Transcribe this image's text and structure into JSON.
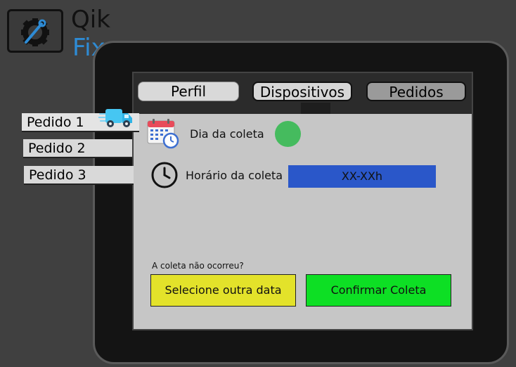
{
  "brand": {
    "name_part1": "Qik",
    "name_part2": "Fix",
    "logo_icon": "gear-wrench-icon"
  },
  "tabs": [
    {
      "label": "Perfil"
    },
    {
      "label": "Dispositivos"
    },
    {
      "label": "Pedidos",
      "active": true
    }
  ],
  "orders": [
    {
      "label": "Pedido 1",
      "icon": "delivery-truck-icon",
      "selected": true
    },
    {
      "label": "Pedido 2"
    },
    {
      "label": "Pedido 3"
    }
  ],
  "pickup": {
    "date_label": "Dia da coleta",
    "date_icon": "calendar-clock-icon",
    "date_status_color": "#45bb5e",
    "time_label": "Horário da coleta",
    "time_icon": "clock-icon",
    "time_value": "XX-XXh"
  },
  "actions": {
    "question": "A coleta não ocorreu?",
    "other_date_label": "Selecione outra data",
    "confirm_label": "Confirmar Coleta"
  },
  "colors": {
    "brand_blue": "#2e8bd4",
    "time_box": "#2a57c9",
    "other_date_button": "#e3e22a",
    "confirm_button": "#0ddf24"
  }
}
